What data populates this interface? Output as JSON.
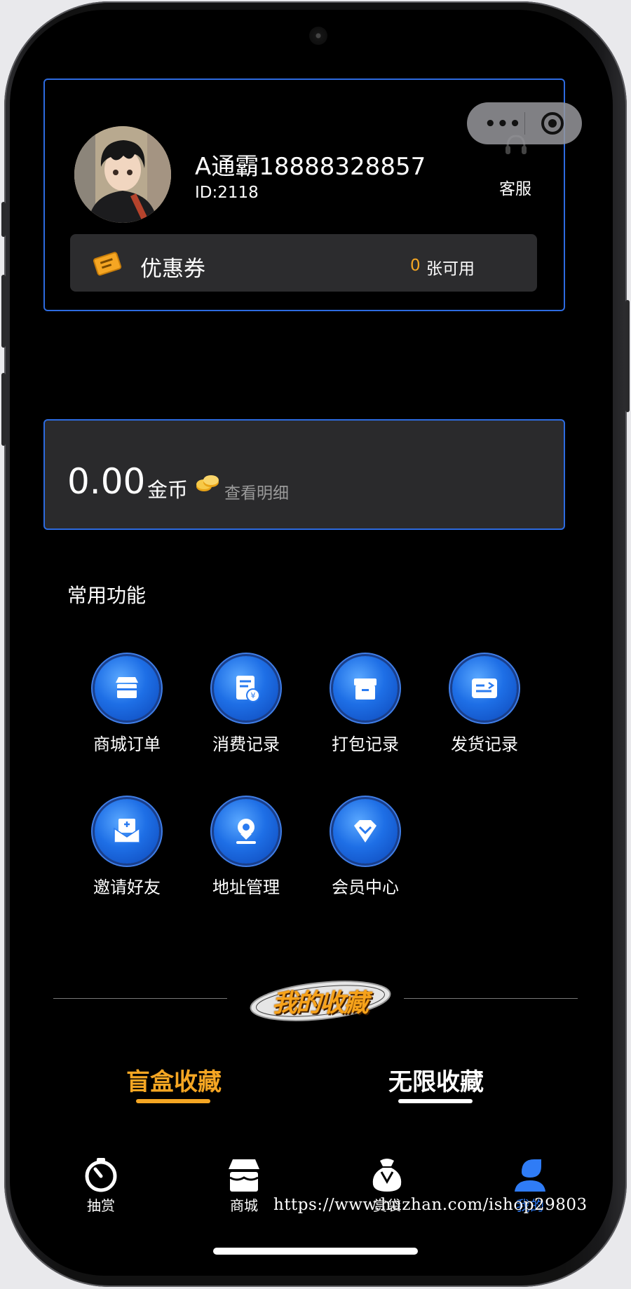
{
  "user": {
    "name": "A通霸18888328857",
    "id_text": "ID:2118"
  },
  "service": {
    "label": "客服"
  },
  "coupon": {
    "label": "优惠券",
    "count": "0",
    "suffix": "张可用"
  },
  "wallet": {
    "value": "0.00",
    "unit": "金币",
    "detail_link": "查看明细"
  },
  "functions": {
    "title": "常用功能",
    "items": [
      {
        "label": "商城订单",
        "icon": "store-icon"
      },
      {
        "label": "消费记录",
        "icon": "receipt-icon"
      },
      {
        "label": "打包记录",
        "icon": "box-icon"
      },
      {
        "label": "发货记录",
        "icon": "shipping-icon"
      },
      {
        "label": "邀请好友",
        "icon": "invite-icon"
      },
      {
        "label": "地址管理",
        "icon": "location-icon"
      },
      {
        "label": "会员中心",
        "icon": "diamond-icon"
      }
    ]
  },
  "collection": {
    "badge": "我的收藏",
    "tabs": [
      {
        "label": "盲盒收藏",
        "active": true
      },
      {
        "label": "无限收藏",
        "active": false
      }
    ]
  },
  "navbar": {
    "items": [
      {
        "label": "抽赏",
        "icon": "timer-icon"
      },
      {
        "label": "商城",
        "icon": "shop-icon"
      },
      {
        "label": "赏袋",
        "icon": "bag-icon"
      },
      {
        "label": "我的",
        "icon": "user-icon",
        "active": true
      }
    ]
  },
  "watermark": "https://www.huzhan.com/ishop29803",
  "colors": {
    "accent_blue": "#2d6be0",
    "accent_orange": "#f5a623",
    "card_bg": "#2c2c2e"
  }
}
